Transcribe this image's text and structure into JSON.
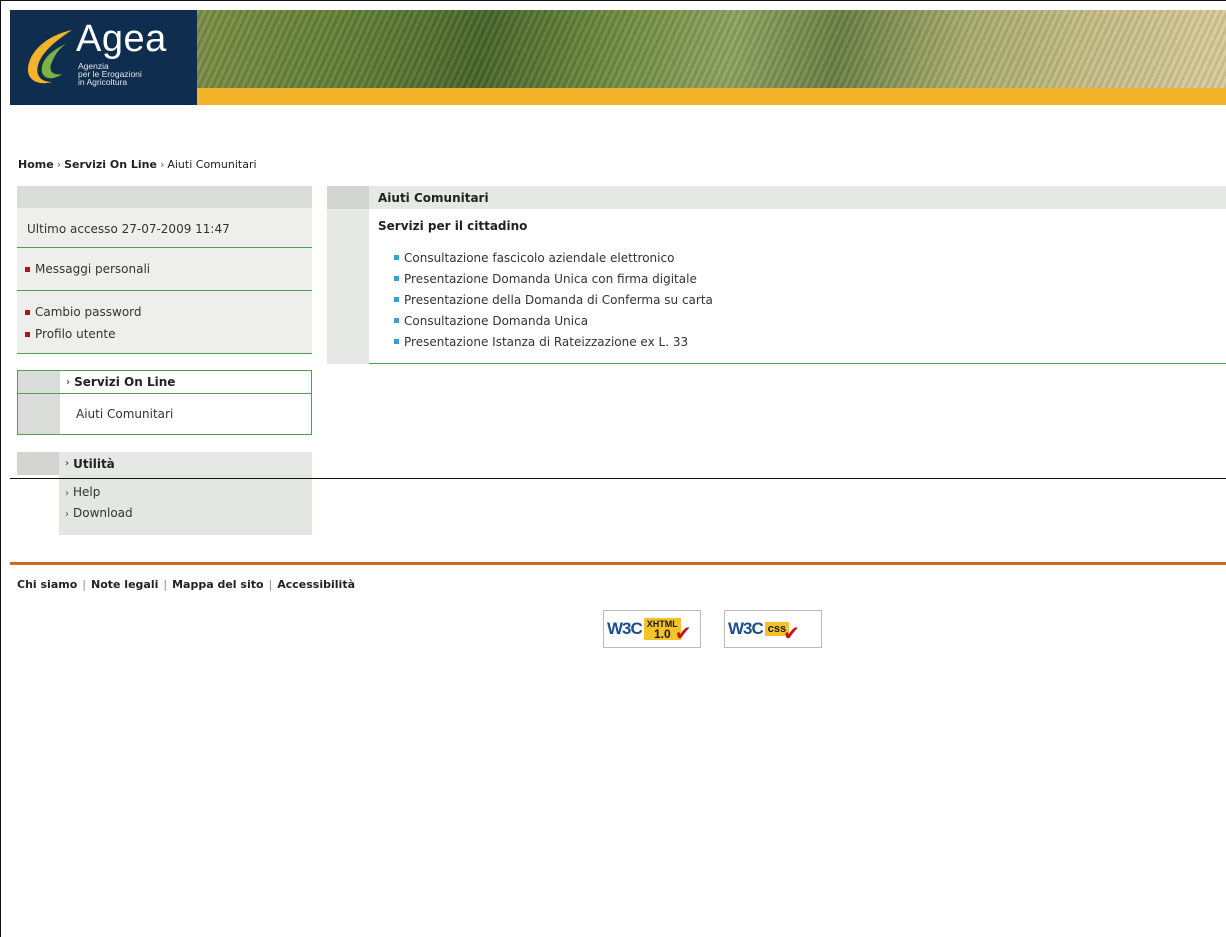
{
  "header": {
    "logo_text": "Agea",
    "logo_subtitle": [
      "Agenzia",
      "per le Erogazioni",
      "in Agricoltura"
    ]
  },
  "breadcrumb": {
    "home": "Home",
    "servizi": "Servizi On Line",
    "current": "Aiuti Comunitari",
    "separator": "›"
  },
  "sidebar": {
    "last_access": "Ultimo accesso 27-07-2009 11:47",
    "messages": "Messaggi personali",
    "change_password": "Cambio password",
    "profile": "Profilo utente",
    "services_title": "Servizi On Line",
    "services_item": "Aiuti Comunitari",
    "utility_title": "Utilità",
    "utility_items": [
      "Help",
      "Download"
    ],
    "chevron": "›"
  },
  "main": {
    "title": "Aiuti Comunitari",
    "subtitle": "Servizi per il cittadino",
    "services": [
      "Consultazione fascicolo aziendale elettronico",
      "Presentazione Domanda Unica con firma digitale",
      "Presentazione della Domanda di Conferma su carta",
      "Consultazione Domanda Unica",
      "Presentazione Istanza di Rateizzazione ex L. 33"
    ]
  },
  "footer": {
    "links": [
      "Chi siamo",
      "Note legali",
      "Mappa del sito",
      "Accessibilità"
    ],
    "pipe": "|",
    "badges": {
      "w3c": "W3C",
      "xhtml_label": "XHTML",
      "xhtml_version": "1.0",
      "css_label": "css"
    }
  },
  "colors": {
    "logo_bg": "#0f2d4e",
    "stripe": "#f3b32a",
    "green_rule": "#4aa54a",
    "footer_rule": "#c15a1d",
    "bullet_red": "#b3121c",
    "bullet_blue": "#3b9dd6"
  }
}
